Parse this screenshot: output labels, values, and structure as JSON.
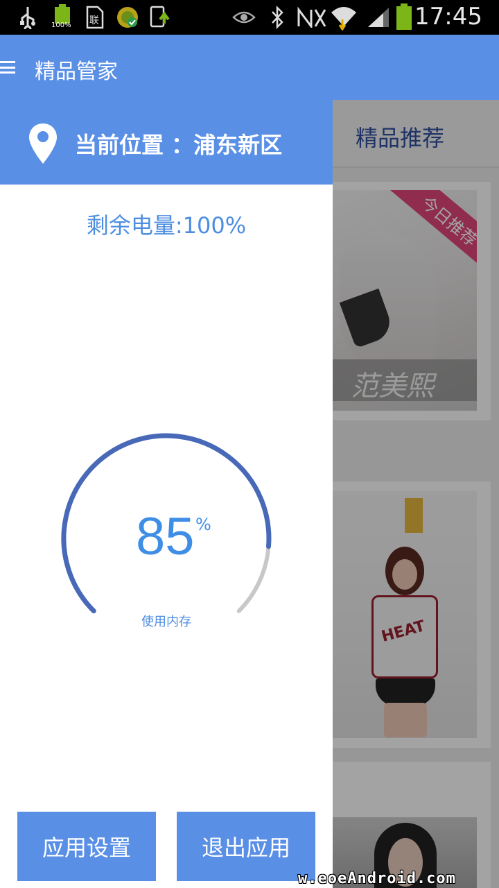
{
  "status_bar": {
    "time": "17:45",
    "icons": [
      "usb-icon",
      "battery-full-icon",
      "sim-card-icon",
      "app-update-icon",
      "download-icon",
      "eye-icon",
      "bluetooth-icon",
      "no-signal-icon",
      "wifi-icon",
      "cell-signal-icon",
      "battery-icon"
    ],
    "battery_small_label": "100%"
  },
  "app_bar": {
    "title": "精品管家",
    "menu_icon": "hamburger-menu-icon"
  },
  "drawer": {
    "location_label": "当前位置",
    "location_value": "：浦东新区",
    "battery_text": "剩余电量:100%",
    "memory_percent": "85",
    "memory_unit": "%",
    "memory_label": "使用内存",
    "memory_fraction": 0.85,
    "buttons": {
      "settings": "应用设置",
      "exit": "退出应用"
    }
  },
  "main": {
    "tab_label": "精品推荐",
    "card1_ribbon": "今日推荐",
    "card1_caption": "范美熙",
    "card2_shirt_text": "HEAT"
  },
  "watermark": "w.eoeAndroid.com",
  "colors": {
    "primary": "#5a8fe6",
    "gauge_fill": "#4869b8",
    "gauge_track": "#c8c8c8",
    "text_accent": "#3f8ee6"
  }
}
